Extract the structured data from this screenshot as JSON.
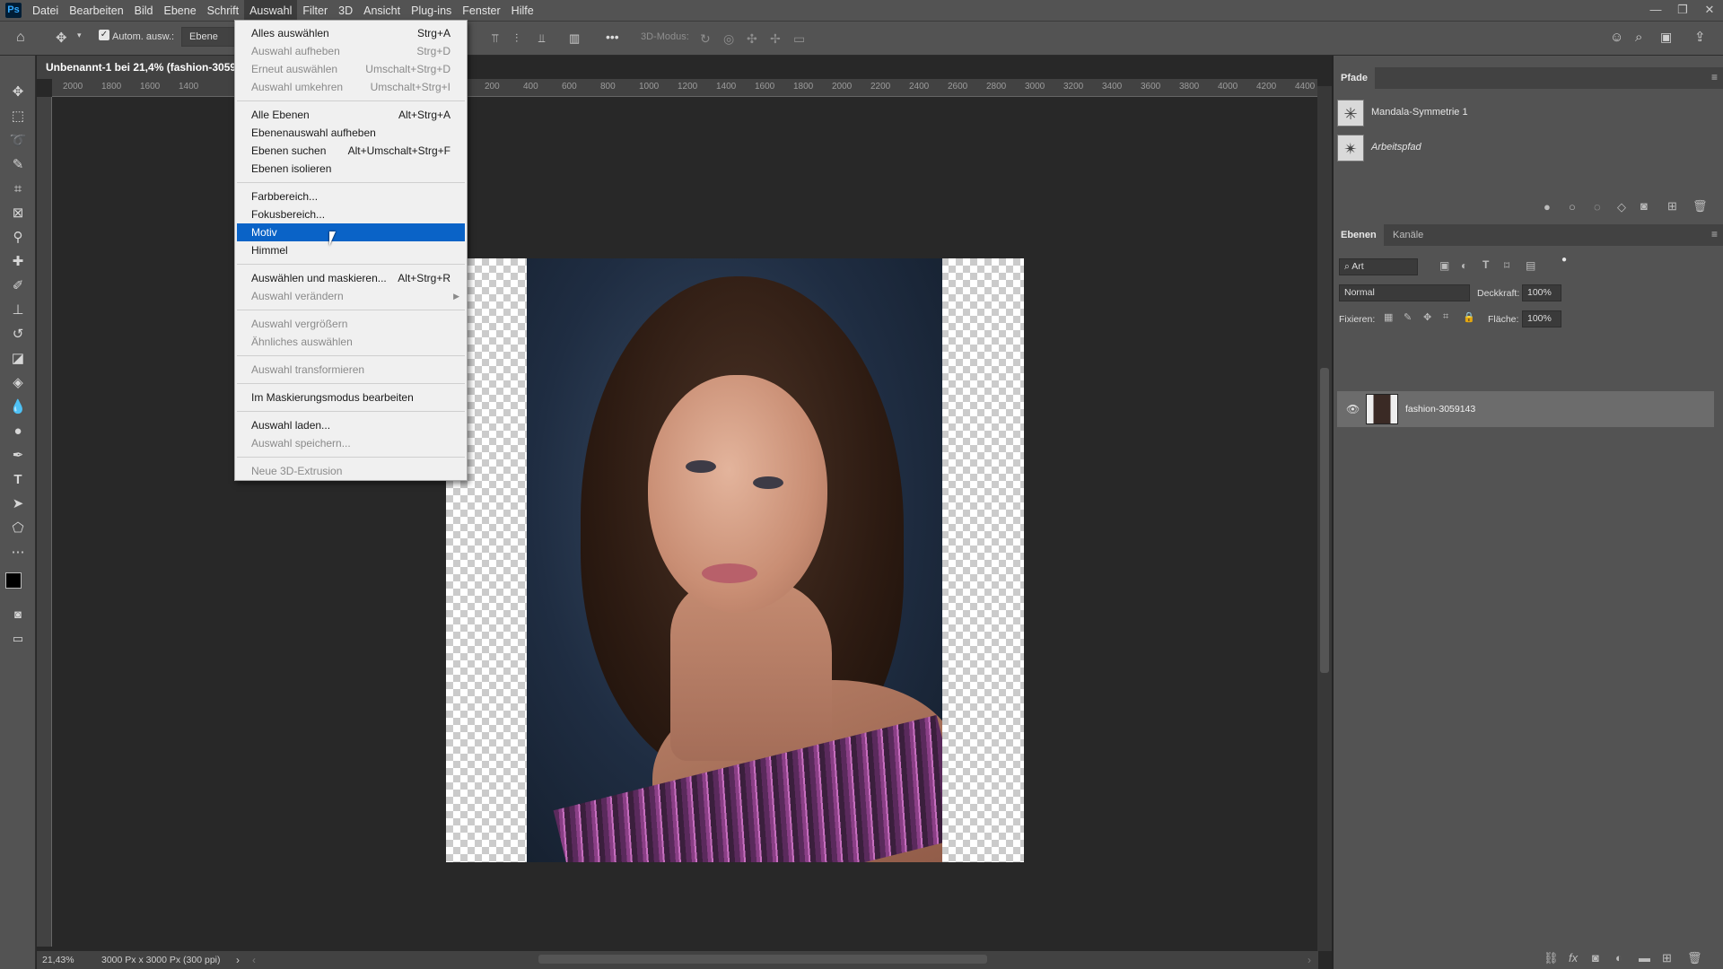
{
  "app": {
    "logo": "Ps"
  },
  "menubar": {
    "items": [
      "Datei",
      "Bearbeiten",
      "Bild",
      "Ebene",
      "Schrift",
      "Auswahl",
      "Filter",
      "3D",
      "Ansicht",
      "Plug-ins",
      "Fenster",
      "Hilfe"
    ],
    "active": "Auswahl"
  },
  "window_controls": {
    "minimize": "—",
    "restore": "❐",
    "close": "✕"
  },
  "options_bar": {
    "auto_select_label": "Autom. ausw.:",
    "auto_select_value": "Ebene",
    "mode_3d_label": "3D-Modus:",
    "more": "•••"
  },
  "document": {
    "tab_title": "Unbenannt-1 bei 21,4% (fashion-3059143/RGB/8)",
    "zoom": "21,43%",
    "doc_info": "3000 Px x 3000 Px (300 ppi)"
  },
  "rulers": {
    "h_left": [
      "2000",
      "1800",
      "1600",
      "1400"
    ],
    "h_right": [
      "200",
      "400",
      "600",
      "800",
      "1000",
      "1200",
      "1400",
      "1600",
      "1800",
      "2000",
      "2200",
      "2400",
      "2600",
      "2800",
      "3000",
      "3200",
      "3400",
      "3600",
      "3800",
      "4000",
      "4200",
      "4400"
    ]
  },
  "dropdown": {
    "items": [
      {
        "label": "Alles auswählen",
        "shortcut": "Strg+A",
        "disabled": false
      },
      {
        "label": "Auswahl aufheben",
        "shortcut": "Strg+D",
        "disabled": true
      },
      {
        "label": "Erneut auswählen",
        "shortcut": "Umschalt+Strg+D",
        "disabled": true
      },
      {
        "label": "Auswahl umkehren",
        "shortcut": "Umschalt+Strg+I",
        "disabled": true
      },
      {
        "label": "Alle Ebenen",
        "shortcut": "Alt+Strg+A",
        "disabled": false
      },
      {
        "label": "Ebenenauswahl aufheben",
        "shortcut": "",
        "disabled": false
      },
      {
        "label": "Ebenen suchen",
        "shortcut": "Alt+Umschalt+Strg+F",
        "disabled": false
      },
      {
        "label": "Ebenen isolieren",
        "shortcut": "",
        "disabled": false
      },
      {
        "label": "Farbbereich...",
        "shortcut": "",
        "disabled": false
      },
      {
        "label": "Fokusbereich...",
        "shortcut": "",
        "disabled": false
      },
      {
        "label": "Motiv",
        "shortcut": "",
        "disabled": false,
        "highlighted": true
      },
      {
        "label": "Himmel",
        "shortcut": "",
        "disabled": false
      },
      {
        "label": "Auswählen und maskieren...",
        "shortcut": "Alt+Strg+R",
        "disabled": false
      },
      {
        "label": "Auswahl verändern",
        "shortcut": "",
        "disabled": true,
        "submenu": true
      },
      {
        "label": "Auswahl vergrößern",
        "shortcut": "",
        "disabled": true
      },
      {
        "label": "Ähnliches auswählen",
        "shortcut": "",
        "disabled": true
      },
      {
        "label": "Auswahl transformieren",
        "shortcut": "",
        "disabled": true
      },
      {
        "label": "Im Maskierungsmodus bearbeiten",
        "shortcut": "",
        "disabled": false
      },
      {
        "label": "Auswahl laden...",
        "shortcut": "",
        "disabled": false
      },
      {
        "label": "Auswahl speichern...",
        "shortcut": "",
        "disabled": true
      },
      {
        "label": "Neue 3D-Extrusion",
        "shortcut": "",
        "disabled": true
      }
    ]
  },
  "paths_panel": {
    "tab": "Pfade",
    "items": [
      {
        "label": "Mandala-Symmetrie 1",
        "italic": false
      },
      {
        "label": "Arbeitspfad",
        "italic": true
      }
    ]
  },
  "layers_panel": {
    "tabs": [
      "Ebenen",
      "Kanäle"
    ],
    "filter_label": "Art",
    "blend_mode": "Normal",
    "opacity_label": "Deckkraft:",
    "opacity_value": "100%",
    "lock_label": "Fixieren:",
    "fill_label": "Fläche:",
    "fill_value": "100%",
    "layers": [
      {
        "name": "fashion-3059143",
        "visible": true
      }
    ]
  }
}
